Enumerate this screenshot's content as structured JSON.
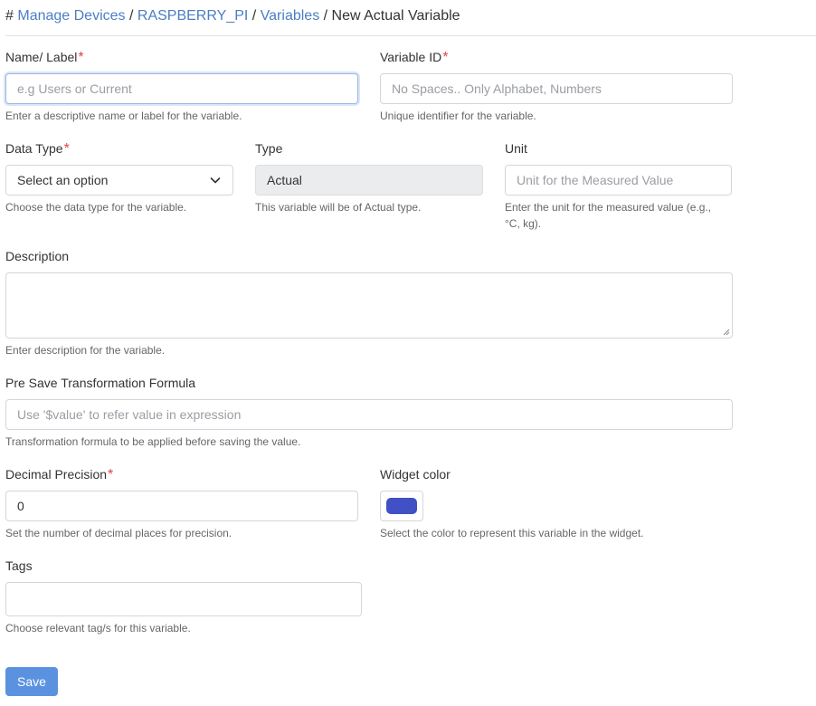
{
  "breadcrumb": {
    "hash": "#",
    "items": [
      "Manage Devices",
      "RASPBERRY_PI",
      "Variables"
    ],
    "current": "New Actual Variable",
    "separator": "/"
  },
  "form": {
    "name": {
      "label": "Name/ Label",
      "required": "*",
      "placeholder": "e.g Users or Current",
      "help": "Enter a descriptive name or label for the variable."
    },
    "variable_id": {
      "label": "Variable ID",
      "required": "*",
      "placeholder": "No Spaces.. Only Alphabet, Numbers",
      "help": "Unique identifier for the variable."
    },
    "data_type": {
      "label": "Data Type",
      "required": "*",
      "selected": "Select an option",
      "help": "Choose the data type for the variable."
    },
    "type": {
      "label": "Type",
      "value": "Actual",
      "help": "This variable will be of Actual type."
    },
    "unit": {
      "label": "Unit",
      "placeholder": "Unit for the Measured Value",
      "help_line1": "Enter the unit for the measured value (e.g.,",
      "help_line2": "°C, kg)."
    },
    "description": {
      "label": "Description",
      "help": "Enter description for the variable."
    },
    "formula": {
      "label": "Pre Save Transformation Formula",
      "placeholder": "Use '$value' to refer value in expression",
      "help": "Transformation formula to be applied before saving the value."
    },
    "decimal_precision": {
      "label": "Decimal Precision",
      "required": "*",
      "value": "0",
      "help": "Set the number of decimal places for precision."
    },
    "widget_color": {
      "label": "Widget color",
      "color": "#3f51c4",
      "help": "Select the color to represent this variable in the widget."
    },
    "tags": {
      "label": "Tags",
      "help": "Choose relevant tag/s for this variable."
    },
    "save_label": "Save"
  }
}
